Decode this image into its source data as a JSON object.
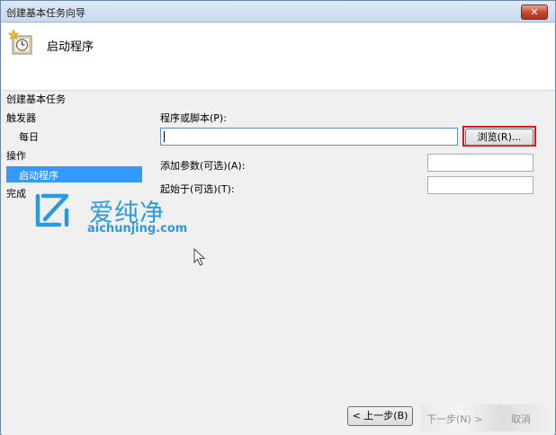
{
  "window": {
    "title": "创建基本任务向导",
    "close_label": "✕"
  },
  "header": {
    "title": "启动程序",
    "icon": "task-clock-icon"
  },
  "nav": {
    "section_label": "创建基本任务",
    "items": [
      {
        "label": "触发器"
      },
      {
        "label": "每日"
      },
      {
        "label": "操作"
      },
      {
        "label": "启动程序",
        "selected": true
      },
      {
        "label": "完成"
      }
    ]
  },
  "form": {
    "program_label": "程序或脚本(P):",
    "program_value": "",
    "browse_label": "浏览(R)...",
    "args_label": "添加参数(可选)(A):",
    "args_value": "",
    "startin_label": "起始于(可选)(T):",
    "startin_value": ""
  },
  "footer": {
    "back_label": "< 上一步(B)",
    "next_label": "下一步(N) >",
    "cancel_label": "取消"
  },
  "watermark": {
    "title": "爱纯净",
    "url": "aichunjing.com"
  },
  "colors": {
    "selection": "#3399ff",
    "highlight_box": "#e0161c",
    "watermark": "#2a9adf"
  }
}
